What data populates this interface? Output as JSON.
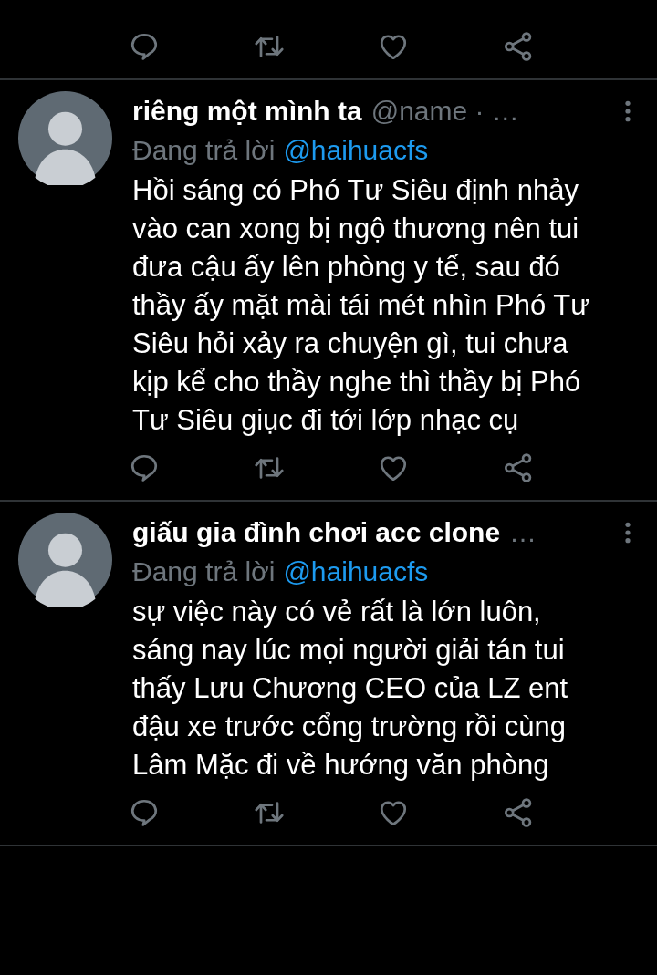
{
  "tweets": [
    {
      "kind": "cut"
    },
    {
      "kind": "full",
      "name": "riêng một mình ta",
      "handle": "@name · …",
      "reply_prefix": "Đang trả lời",
      "reply_to": "@haihuacfs",
      "body": "Hồi sáng có Phó Tư Siêu định nhảy vào can xong bị ngộ thương nên tui đưa cậu ấy lên phòng y tế, sau đó thầy ấy mặt mài tái mét nhìn Phó Tư Siêu hỏi xảy ra chuyện gì, tui chưa kịp kể cho thầy nghe thì thầy bị Phó Tư Siêu giục đi tới lớp nhạc cụ"
    },
    {
      "kind": "full",
      "name": "giấu gia đình chơi acc clone",
      "handle": "…",
      "reply_prefix": "Đang trả lời",
      "reply_to": "@haihuacfs",
      "body": "sự việc này có vẻ rất là lớn luôn, sáng nay lúc mọi người giải tán tui thấy Lưu Chương CEO của LZ ent đậu xe trước cổng trường rồi cùng Lâm Mặc đi về hướng văn phòng"
    }
  ]
}
